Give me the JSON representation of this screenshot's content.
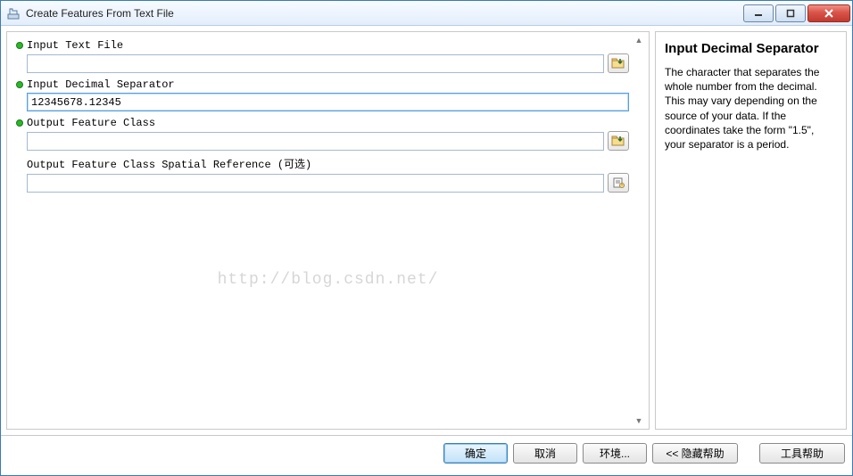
{
  "window": {
    "title": "Create Features From Text File"
  },
  "fields": {
    "input_text_file": {
      "label": "Input Text File",
      "value": ""
    },
    "input_decimal_separator": {
      "label": "Input Decimal Separator",
      "value": "12345678.12345"
    },
    "output_feature_class": {
      "label": "Output Feature Class",
      "value": ""
    },
    "output_spatial_ref": {
      "label": "Output Feature Class Spatial Reference (可选)",
      "value": ""
    }
  },
  "help": {
    "title": "Input Decimal Separator",
    "body": "The character that separates the whole number from the decimal. This may vary depending on the source of your data. If the coordinates take the form \"1.5\", your separator is a period."
  },
  "buttons": {
    "ok": "确定",
    "cancel": "取消",
    "environments": "环境...",
    "hide_help": "<< 隐藏帮助",
    "tool_help": "工具帮助"
  },
  "watermark": "http://blog.csdn.net/"
}
